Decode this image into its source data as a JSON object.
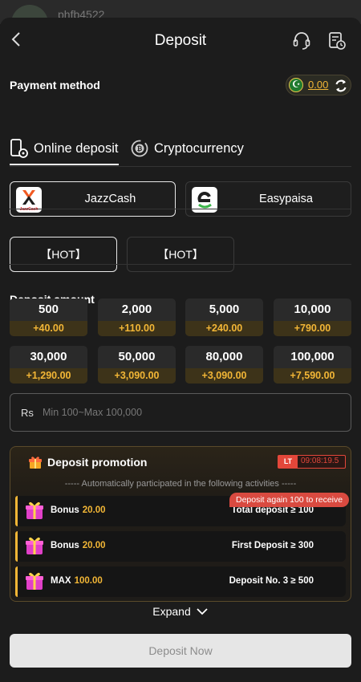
{
  "background_app": {
    "username": "phfb4522"
  },
  "header": {
    "title": "Deposit",
    "back_icon": "chevron-left-icon",
    "support_icon": "headset-icon",
    "history_icon": "history-icon"
  },
  "payment": {
    "label": "Payment method",
    "balance": "0.00",
    "tabs": [
      {
        "label": "Online deposit",
        "active": true
      },
      {
        "label": "Cryptocurrency",
        "active": false
      }
    ],
    "channels": [
      {
        "label": "JazzCash",
        "logo_text": "JazzCash",
        "selected": true
      },
      {
        "label": "Easypaisa",
        "selected": false
      }
    ],
    "sub_channels": [
      {
        "label": "【HOT】",
        "selected": true
      },
      {
        "label": "【HOT】",
        "selected": false
      }
    ]
  },
  "deposit_amount": {
    "label": "Deposit amount",
    "options": [
      {
        "amount": "500",
        "bonus": "+40.00"
      },
      {
        "amount": "2,000",
        "bonus": "+110.00"
      },
      {
        "amount": "5,000",
        "bonus": "+240.00"
      },
      {
        "amount": "10,000",
        "bonus": "+790.00"
      },
      {
        "amount": "30,000",
        "bonus": "+1,290.00"
      },
      {
        "amount": "50,000",
        "bonus": "+3,090.00"
      },
      {
        "amount": "80,000",
        "bonus": "+3,090.00"
      },
      {
        "amount": "100,000",
        "bonus": "+7,590.00"
      }
    ],
    "currency_prefix": "Rs",
    "placeholder": "Min 100~Max 100,000",
    "value": ""
  },
  "promotion": {
    "title": "Deposit promotion",
    "lt_badge": "LT",
    "countdown": "09:08:19.5",
    "subtitle": "----- Automatically participated in the following activities -----",
    "tooltip": "Deposit again 100 to receive",
    "items": [
      {
        "name": "Bonus",
        "amount": "20.00",
        "condition": "Total deposit ≥ 100"
      },
      {
        "name": "Bonus",
        "amount": "20.00",
        "condition": "First Deposit ≥ 300"
      },
      {
        "name": "MAX",
        "amount": "100.00",
        "condition": "Deposit No. 3 ≥ 500"
      }
    ],
    "expand_label": "Expand"
  },
  "submit": {
    "label": "Deposit Now"
  },
  "colors": {
    "accent": "#f2b636",
    "alert": "#e3473a",
    "background": "#1c1c1c"
  }
}
